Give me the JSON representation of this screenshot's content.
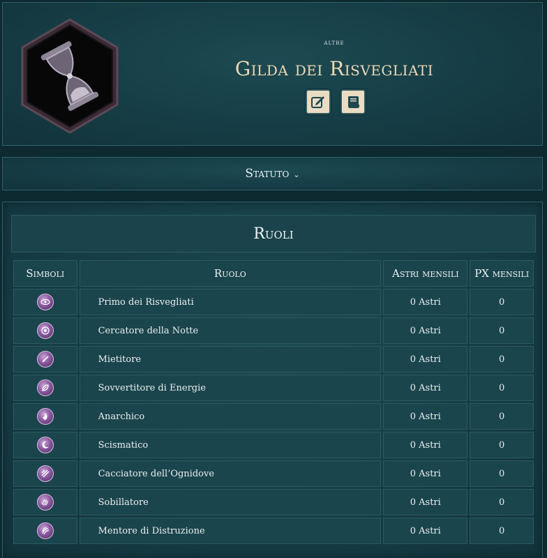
{
  "header": {
    "category": "ALTRE",
    "title": "Gilda dei Risvegliati",
    "emblem_icon": "hourglass-icon",
    "buttons": [
      {
        "icon": "edit-icon"
      },
      {
        "icon": "scroll-icon"
      }
    ]
  },
  "statute": {
    "label": "Statuto",
    "icon": "chevron-down-icon"
  },
  "roles": {
    "title": "Ruoli",
    "columns": {
      "symbols": "Simboli",
      "role": "Ruolo",
      "monthly_astri": "Astri mensili",
      "monthly_px": "PX mensili"
    },
    "rows": [
      {
        "icon": "eye-sigil-icon",
        "name": "Primo dei Risvegliati",
        "astri": "0 Astri",
        "px": "0"
      },
      {
        "icon": "eye-sigil-icon",
        "name": "Cercatore della Notte",
        "astri": "0 Astri",
        "px": "0"
      },
      {
        "icon": "blade-sigil-icon",
        "name": "Mietitore",
        "astri": "0 Astri",
        "px": "0"
      },
      {
        "icon": "leaf-sigil-icon",
        "name": "Sovvertitore di Energie",
        "astri": "0 Astri",
        "px": "0"
      },
      {
        "icon": "flame-sigil-icon",
        "name": "Anarchico",
        "astri": "0 Astri",
        "px": "0"
      },
      {
        "icon": "moon-sigil-icon",
        "name": "Scismatico",
        "astri": "0 Astri",
        "px": "0"
      },
      {
        "icon": "stripes-sigil-icon",
        "name": "Cacciatore dell’Ognidove",
        "astri": "0 Astri",
        "px": "0"
      },
      {
        "icon": "spiral-sigil-icon",
        "name": "Sobillatore",
        "astri": "0 Astri",
        "px": "0"
      },
      {
        "icon": "claw-sigil-icon",
        "name": "Mentore di Distruzione",
        "astri": "0 Astri",
        "px": "0"
      }
    ]
  },
  "colors": {
    "background": "#0d2a31",
    "panel": "#163d45",
    "title_gold": "#ecd7b3",
    "icon_purple": "#8b5aa0"
  }
}
